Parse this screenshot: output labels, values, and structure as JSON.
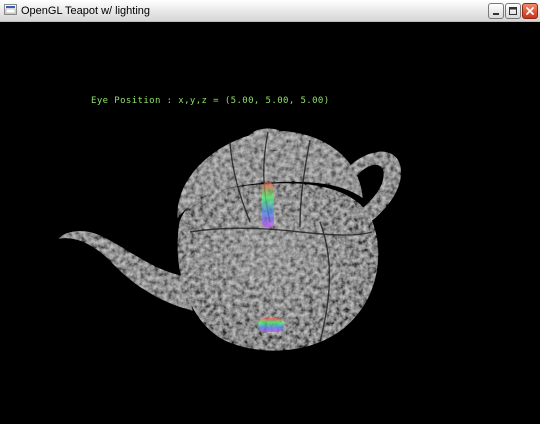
{
  "window": {
    "title": "OpenGL Teapot w/ lighting",
    "icon": "app-window-icon",
    "buttons": {
      "minimize": "minimize-icon",
      "maximize": "maximize-icon",
      "close": "close-icon"
    }
  },
  "scene": {
    "eye_label": "Eye Position : x,y,z = (5.00, 5.00, 5.00)",
    "label_color": "#8fe06b",
    "background_color": "#000000",
    "object": "teapot"
  }
}
